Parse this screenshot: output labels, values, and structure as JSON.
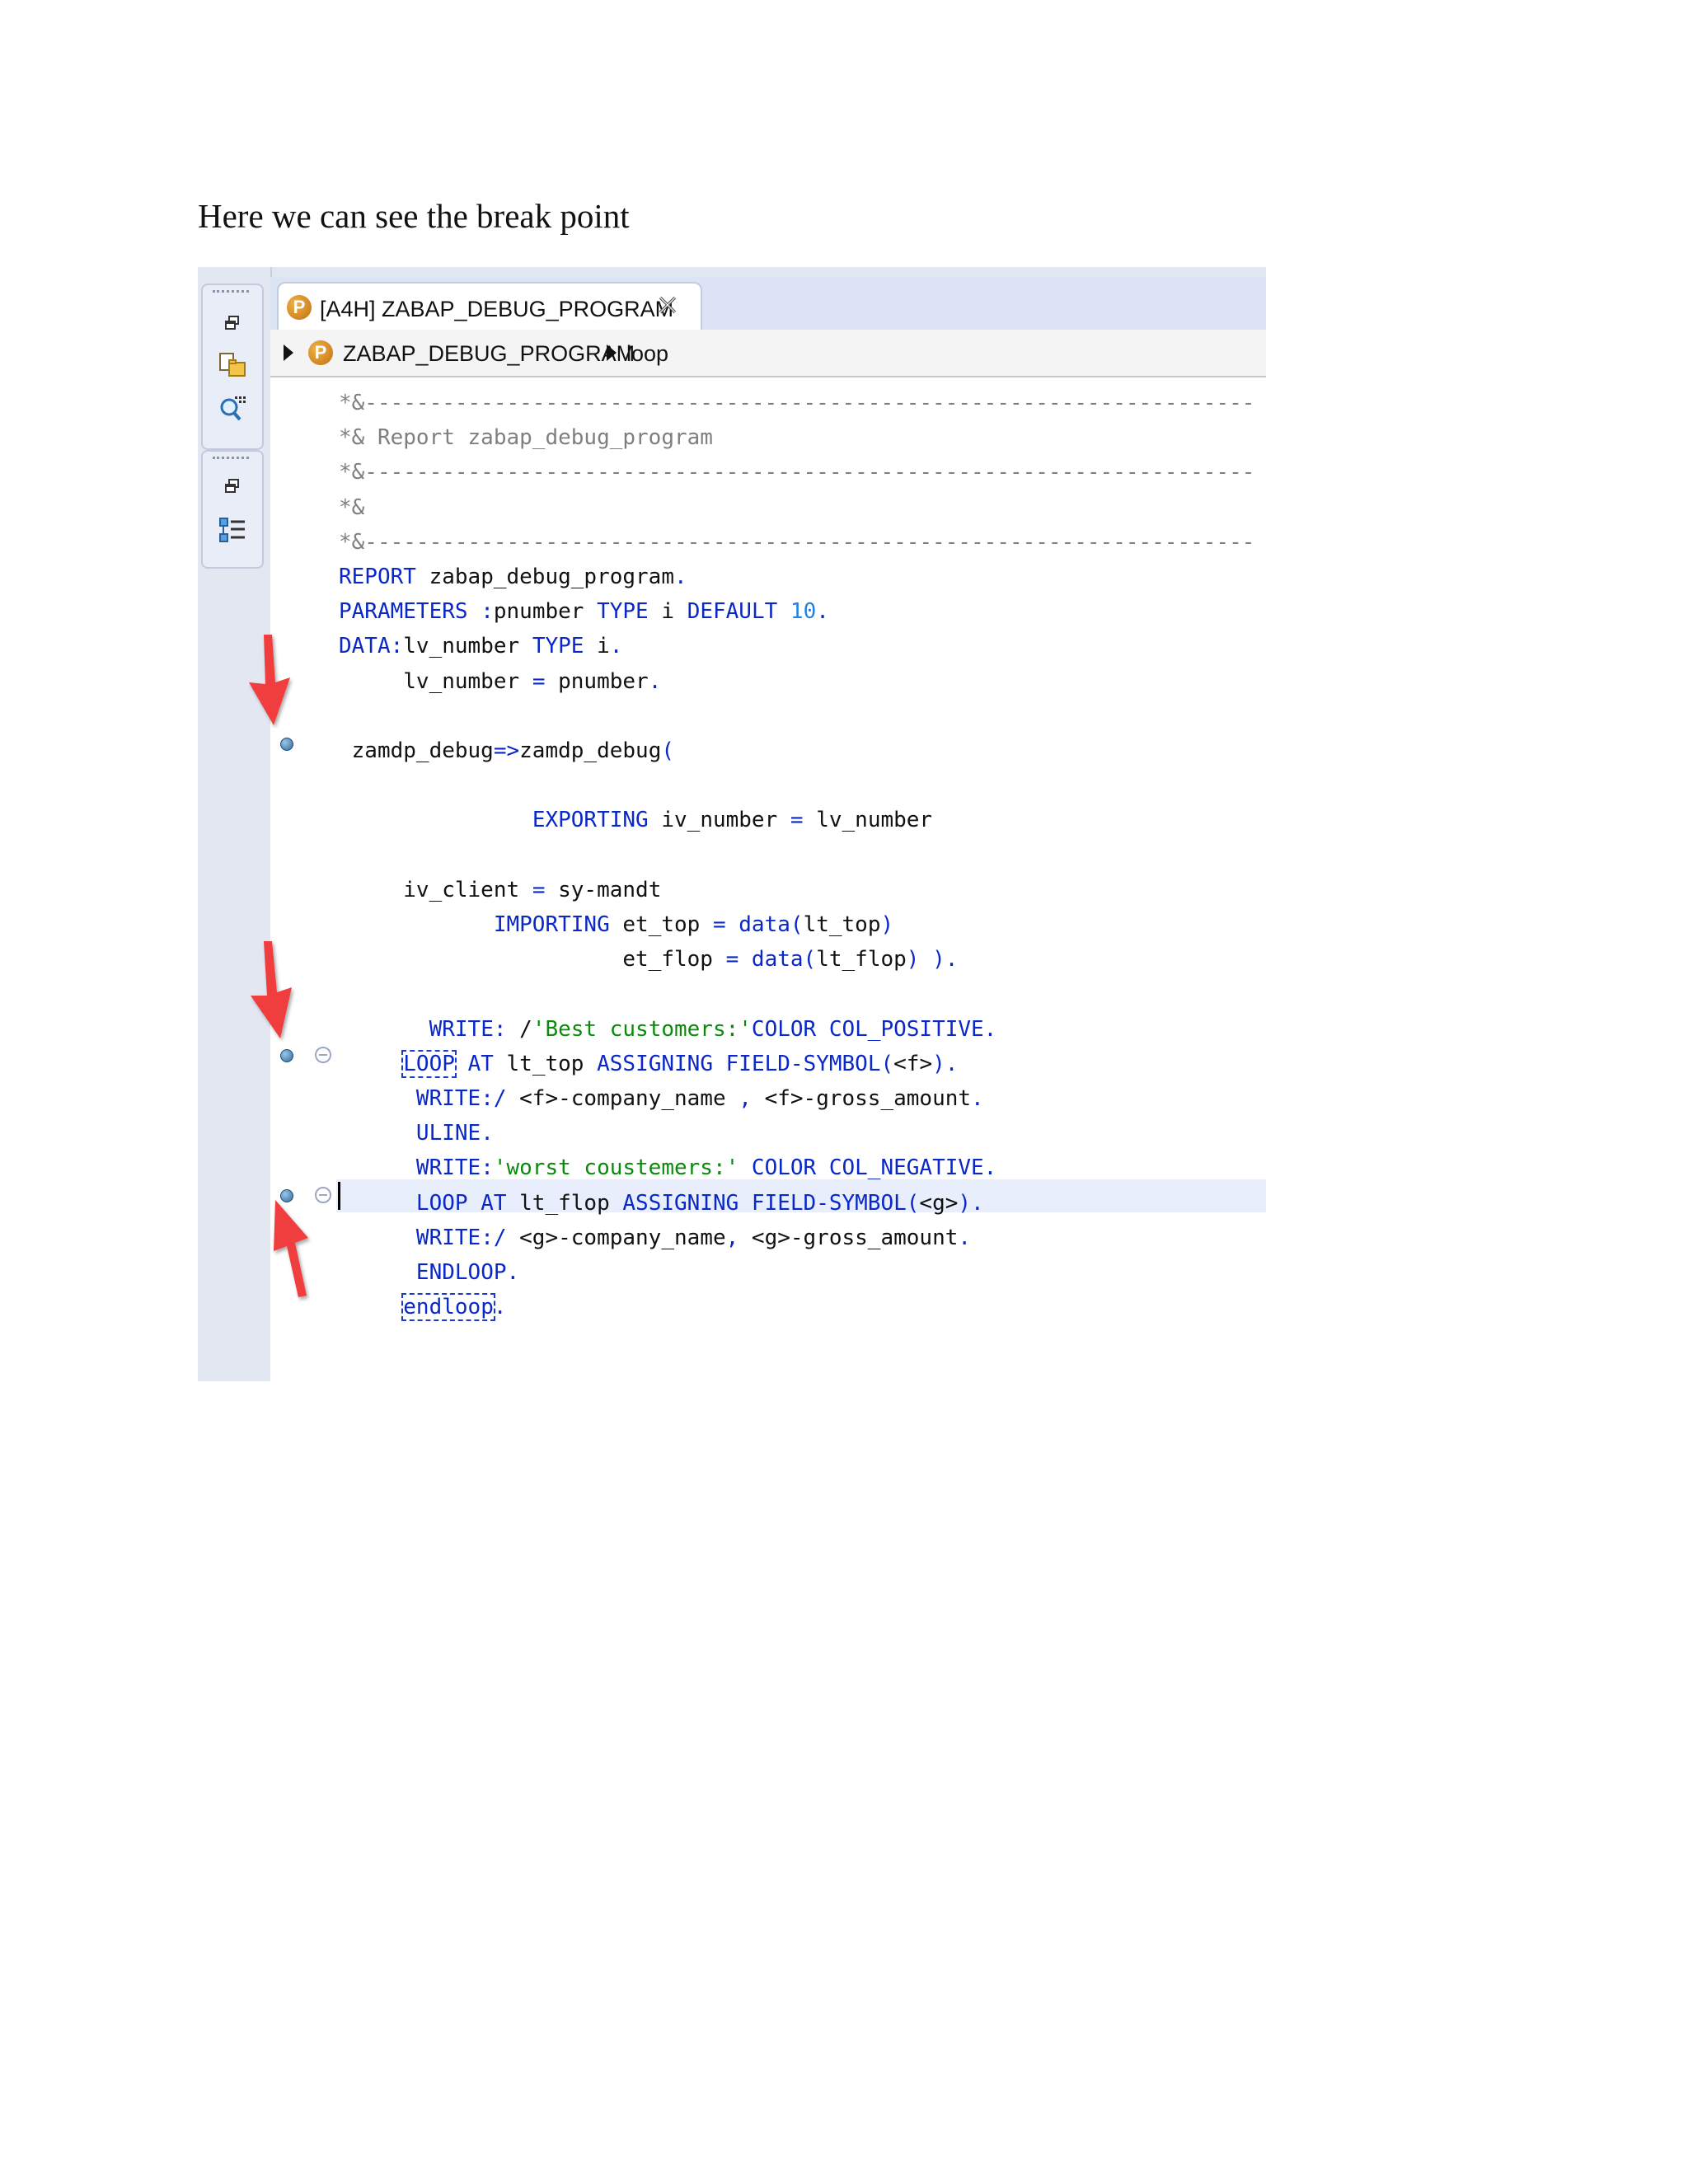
{
  "caption": "Here we can see the break point",
  "editor": {
    "tab_badge": "P",
    "tab_title": "[A4H] ZABAP_DEBUG_PROGRAM",
    "close_glyph": "✕",
    "breadcrumb": [
      "ZABAP_DEBUG_PROGRAM",
      "loop"
    ],
    "accent_color": "#0a28c8",
    "breakpoint_color": "#2e6aa0",
    "arrow_color": "#ff3b30"
  },
  "code_lines": [
    [
      {
        "t": "cm",
        "s": "*&---------------------------------------------------------------------"
      }
    ],
    [
      {
        "t": "cm",
        "s": "*& Report zabap_debug_program"
      }
    ],
    [
      {
        "t": "cm",
        "s": "*&---------------------------------------------------------------------"
      }
    ],
    [
      {
        "t": "cm",
        "s": "*&"
      }
    ],
    [
      {
        "t": "cm",
        "s": "*&---------------------------------------------------------------------"
      }
    ],
    [
      {
        "t": "kw",
        "s": "REPORT"
      },
      {
        "t": "tx",
        "s": " zabap_debug_program"
      },
      {
        "t": "kw",
        "s": "."
      }
    ],
    [
      {
        "t": "kw",
        "s": "PARAMETERS"
      },
      {
        "t": "tx",
        "s": " "
      },
      {
        "t": "kw",
        "s": ":"
      },
      {
        "t": "tx",
        "s": "pnumber "
      },
      {
        "t": "kw",
        "s": "TYPE"
      },
      {
        "t": "tx",
        "s": " i "
      },
      {
        "t": "kw",
        "s": "DEFAULT"
      },
      {
        "t": "tx",
        "s": " "
      },
      {
        "t": "num",
        "s": "10"
      },
      {
        "t": "kw",
        "s": "."
      }
    ],
    [
      {
        "t": "kw",
        "s": "DATA:"
      },
      {
        "t": "tx",
        "s": "lv_number "
      },
      {
        "t": "kw",
        "s": "TYPE"
      },
      {
        "t": "tx",
        "s": " i"
      },
      {
        "t": "kw",
        "s": "."
      }
    ],
    [
      {
        "t": "tx",
        "s": "     lv_number "
      },
      {
        "t": "kw",
        "s": "="
      },
      {
        "t": "tx",
        "s": " pnumber"
      },
      {
        "t": "kw",
        "s": "."
      }
    ],
    [],
    [
      {
        "t": "tx",
        "s": " zamdp_debug"
      },
      {
        "t": "kw",
        "s": "=>"
      },
      {
        "t": "tx",
        "s": "zamdp_debug"
      },
      {
        "t": "kw",
        "s": "("
      }
    ],
    [],
    [
      {
        "t": "tx",
        "s": "               "
      },
      {
        "t": "kw",
        "s": "EXPORTING"
      },
      {
        "t": "tx",
        "s": " iv_number "
      },
      {
        "t": "kw",
        "s": "="
      },
      {
        "t": "tx",
        "s": " lv_number"
      }
    ],
    [],
    [
      {
        "t": "tx",
        "s": "     iv_client "
      },
      {
        "t": "kw",
        "s": "="
      },
      {
        "t": "tx",
        "s": " sy-mandt"
      }
    ],
    [
      {
        "t": "tx",
        "s": "            "
      },
      {
        "t": "kw",
        "s": "IMPORTING"
      },
      {
        "t": "tx",
        "s": " et_top "
      },
      {
        "t": "kw",
        "s": "="
      },
      {
        "t": "tx",
        "s": " "
      },
      {
        "t": "kw",
        "s": "data("
      },
      {
        "t": "tx",
        "s": "lt_top"
      },
      {
        "t": "kw",
        "s": ")"
      }
    ],
    [
      {
        "t": "tx",
        "s": "                      et_flop "
      },
      {
        "t": "kw",
        "s": "="
      },
      {
        "t": "tx",
        "s": " "
      },
      {
        "t": "kw",
        "s": "data("
      },
      {
        "t": "tx",
        "s": "lt_flop"
      },
      {
        "t": "kw",
        "s": ") )."
      }
    ],
    [],
    [
      {
        "t": "tx",
        "s": "       "
      },
      {
        "t": "kw",
        "s": "WRITE:"
      },
      {
        "t": "tx",
        "s": " /"
      },
      {
        "t": "str",
        "s": "'Best customers:'"
      },
      {
        "t": "kw",
        "s": "COLOR COL_POSITIVE."
      }
    ],
    [
      {
        "t": "tx",
        "s": "     "
      },
      {
        "t": "box",
        "s": "LOOP"
      },
      {
        "t": "tx",
        "s": " "
      },
      {
        "t": "kw",
        "s": "AT"
      },
      {
        "t": "tx",
        "s": " lt_top "
      },
      {
        "t": "kw",
        "s": "ASSIGNING FIELD-SYMBOL("
      },
      {
        "t": "tx",
        "s": "<f>"
      },
      {
        "t": "kw",
        "s": ")."
      }
    ],
    [
      {
        "t": "tx",
        "s": "      "
      },
      {
        "t": "kw",
        "s": "WRITE:/"
      },
      {
        "t": "tx",
        "s": " <f>-company_name "
      },
      {
        "t": "kw",
        "s": ","
      },
      {
        "t": "tx",
        "s": " <f>-gross_amount"
      },
      {
        "t": "kw",
        "s": "."
      }
    ],
    [
      {
        "t": "tx",
        "s": "      "
      },
      {
        "t": "kw",
        "s": "ULINE."
      }
    ],
    [
      {
        "t": "tx",
        "s": "      "
      },
      {
        "t": "kw",
        "s": "WRITE:"
      },
      {
        "t": "str",
        "s": "'worst coustemers:'"
      },
      {
        "t": "tx",
        "s": " "
      },
      {
        "t": "kw",
        "s": "COLOR COL_NEGATIVE."
      }
    ],
    [
      {
        "t": "tx",
        "s": "      "
      },
      {
        "t": "kw",
        "s": "LOOP AT"
      },
      {
        "t": "tx",
        "s": " lt_flop "
      },
      {
        "t": "kw",
        "s": "ASSIGNING FIELD-SYMBOL("
      },
      {
        "t": "tx",
        "s": "<g>"
      },
      {
        "t": "kw",
        "s": ")."
      }
    ],
    [
      {
        "t": "tx",
        "s": "      "
      },
      {
        "t": "kw",
        "s": "WRITE:/"
      },
      {
        "t": "tx",
        "s": " <g>-company_name"
      },
      {
        "t": "kw",
        "s": ","
      },
      {
        "t": "tx",
        "s": " <g>-gross_amount"
      },
      {
        "t": "kw",
        "s": "."
      }
    ],
    [
      {
        "t": "tx",
        "s": "      "
      },
      {
        "t": "kw",
        "s": "ENDLOOP."
      }
    ],
    [
      {
        "t": "tx",
        "s": "     "
      },
      {
        "t": "box",
        "s": "endloop"
      },
      {
        "t": "kw",
        "s": "."
      }
    ]
  ]
}
